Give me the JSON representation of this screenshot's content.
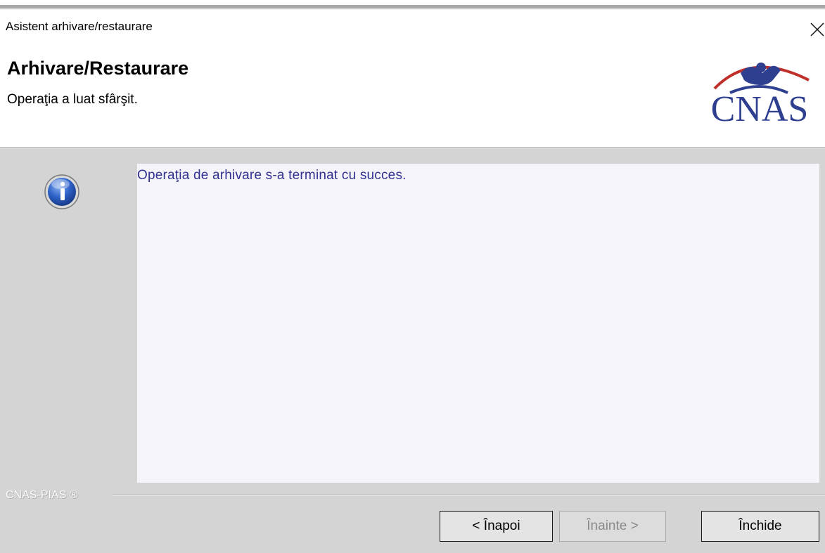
{
  "window": {
    "title": "Asistent arhivare/restaurare",
    "close_icon": "close-icon"
  },
  "header": {
    "title": "Arhivare/Restaurare",
    "subtitle": "Operaţia a luat sfârşit.",
    "logo_text": "CNAS",
    "logo_colors": {
      "text": "#2f3f8f",
      "arc": "#c0302a"
    }
  },
  "content": {
    "icon": "info-icon",
    "message": "Operaţia de arhivare s-a terminat cu succes.",
    "message_color": "#31318f"
  },
  "footer": {
    "label": "CNAS-PIAS ®"
  },
  "buttons": {
    "back": "< Înapoi",
    "next": "Înainte >",
    "close": "Închide"
  }
}
